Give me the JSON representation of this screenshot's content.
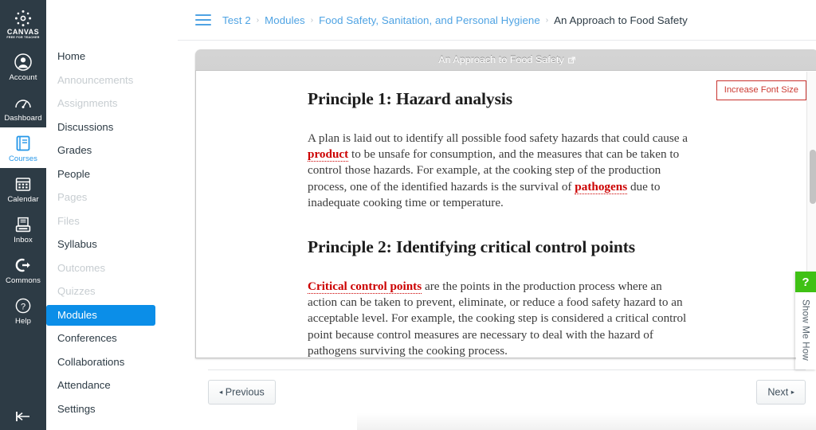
{
  "global_nav": {
    "logo": {
      "word": "CANVAS",
      "sub": "FREE FOR TEACHER",
      "icon": "canvas-logo-icon"
    },
    "items": [
      {
        "label": "Account",
        "icon": "user-circle-icon",
        "active": false
      },
      {
        "label": "Dashboard",
        "icon": "speedometer-icon",
        "active": false
      },
      {
        "label": "Courses",
        "icon": "book-icon",
        "active": true
      },
      {
        "label": "Calendar",
        "icon": "calendar-icon",
        "active": false
      },
      {
        "label": "Inbox",
        "icon": "inbox-tray-icon",
        "active": false
      },
      {
        "label": "Commons",
        "icon": "arrow-out-circle-icon",
        "active": false
      },
      {
        "label": "Help",
        "icon": "question-circle-icon",
        "active": false
      }
    ],
    "collapse_icon": "collapse-left-icon"
  },
  "course_nav": {
    "items": [
      {
        "label": "Home",
        "state": "normal"
      },
      {
        "label": "Announcements",
        "state": "muted"
      },
      {
        "label": "Assignments",
        "state": "muted"
      },
      {
        "label": "Discussions",
        "state": "normal"
      },
      {
        "label": "Grades",
        "state": "normal"
      },
      {
        "label": "People",
        "state": "normal"
      },
      {
        "label": "Pages",
        "state": "muted"
      },
      {
        "label": "Files",
        "state": "muted"
      },
      {
        "label": "Syllabus",
        "state": "normal"
      },
      {
        "label": "Outcomes",
        "state": "muted"
      },
      {
        "label": "Quizzes",
        "state": "muted"
      },
      {
        "label": "Modules",
        "state": "selected"
      },
      {
        "label": "Conferences",
        "state": "normal"
      },
      {
        "label": "Collaborations",
        "state": "normal"
      },
      {
        "label": "Attendance",
        "state": "normal"
      },
      {
        "label": "Settings",
        "state": "normal"
      }
    ]
  },
  "breadcrumb": {
    "menu_icon": "hamburger-menu-icon",
    "separator": "›",
    "items": [
      {
        "label": "Test 2",
        "current": false
      },
      {
        "label": "Modules",
        "current": false
      },
      {
        "label": "Food Safety, Sanitation, and Personal Hygiene",
        "current": false
      },
      {
        "label": "An Approach to Food Safety",
        "current": true
      }
    ]
  },
  "tool": {
    "title": "An Approach to Food Safety",
    "external_link_icon": "external-link-icon",
    "font_button_label": "Increase Font Size",
    "scrollbar_icon": "vertical-scrollbar"
  },
  "document": {
    "sections": [
      {
        "heading": "Principle 1: Hazard analysis",
        "paragraph_parts": [
          {
            "text": "A plan is laid out to identify all possible food safety hazards that could cause a ",
            "term": false
          },
          {
            "text": "product",
            "term": true
          },
          {
            "text": " to be unsafe for consumption, and the measures that can be taken to control those hazards. For example, at the cooking step of the production process, one of the identified hazards is the survival of ",
            "term": false
          },
          {
            "text": "pathogens",
            "term": true
          },
          {
            "text": " due to inadequate cooking time or temperature.",
            "term": false
          }
        ]
      },
      {
        "heading": "Principle 2: Identifying critical control points",
        "paragraph_parts": [
          {
            "text": "Critical control points",
            "term": true
          },
          {
            "text": " are the points in the production process where an action can be taken to prevent, eliminate, or reduce a food safety hazard to an acceptable level. For example, the cooking step is considered a critical control point because control measures are necessary to deal with the hazard of pathogens surviving the cooking process.",
            "term": false
          }
        ]
      }
    ]
  },
  "footer": {
    "previous_label": "Previous",
    "next_label": "Next",
    "previous_arrow": "◂",
    "next_arrow": "▸"
  },
  "show_me_how": {
    "question_mark": "?",
    "label": "Show Me How",
    "accent_color": "#3fc114"
  },
  "colors": {
    "global_nav_bg": "#2d3b45",
    "link_blue": "#4fa3e3",
    "active_blue": "#0b8ee8",
    "term_red": "#cc0000",
    "button_red": "#c8322e",
    "muted_gray": "#c7cdd1"
  }
}
